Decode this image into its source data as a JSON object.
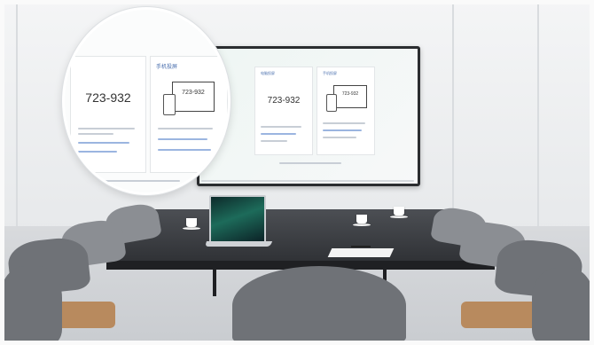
{
  "magnifier": {
    "left_card": {
      "code": "723-932"
    },
    "right_card": {
      "title": "手机投屏",
      "code": "723-932"
    }
  },
  "tv_screen": {
    "left_card": {
      "title": "电脑投屏",
      "code": "723-932"
    },
    "right_card": {
      "title": "手机投屏",
      "code": "723-932"
    }
  },
  "colors": {
    "accent": "#4a6fae",
    "wall": "#eef0f2",
    "table": "#3a3d42",
    "seat": "#b88a5e"
  }
}
